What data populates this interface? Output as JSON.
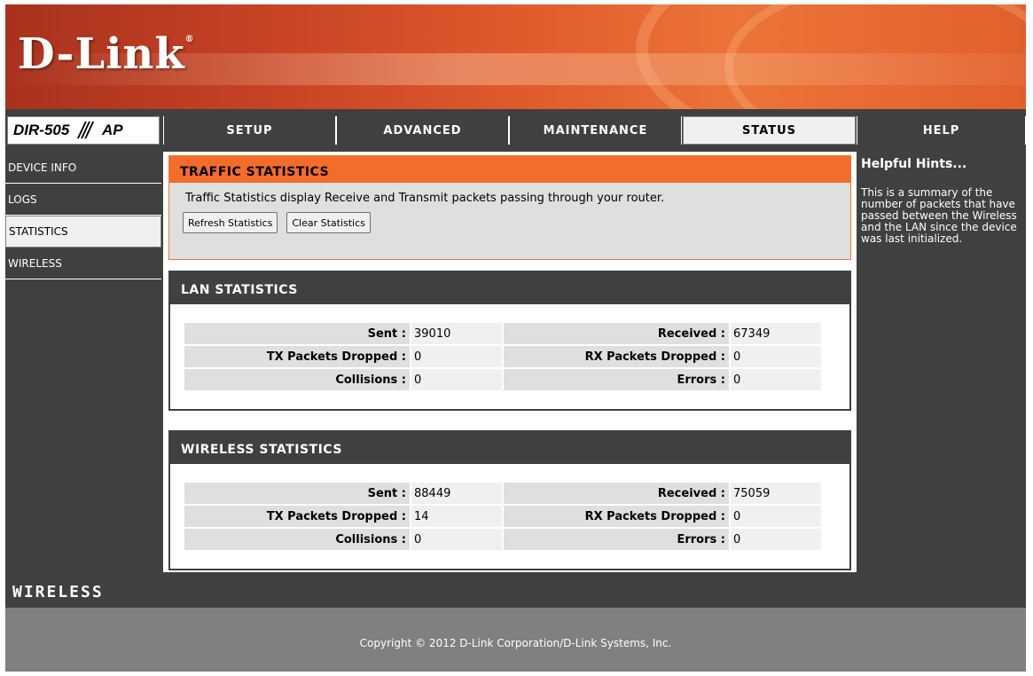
{
  "header": {
    "logo": "D-Link",
    "logo_mark": "®"
  },
  "model": {
    "name": "DIR-505",
    "separator": "///",
    "mode": "AP"
  },
  "nav": {
    "tabs": [
      {
        "label": "SETUP"
      },
      {
        "label": "ADVANCED"
      },
      {
        "label": "MAINTENANCE"
      },
      {
        "label": "STATUS",
        "active": true
      },
      {
        "label": "HELP"
      }
    ]
  },
  "sidebar": {
    "items": [
      {
        "label": "DEVICE INFO"
      },
      {
        "label": "LOGS"
      },
      {
        "label": "STATISTICS",
        "active": true
      },
      {
        "label": "WIRELESS"
      }
    ]
  },
  "traffic": {
    "title": "TRAFFIC STATISTICS",
    "description": "Traffic Statistics display Receive and Transmit packets passing through your router.",
    "refresh_label": "Refresh Statistics",
    "clear_label": "Clear Statistics"
  },
  "lan": {
    "title": "LAN STATISTICS",
    "sent_label": "Sent :",
    "sent": "39010",
    "received_label": "Received :",
    "received": "67349",
    "tx_dropped_label": "TX Packets Dropped :",
    "tx_dropped": "0",
    "rx_dropped_label": "RX Packets Dropped :",
    "rx_dropped": "0",
    "collisions_label": "Collisions :",
    "collisions": "0",
    "errors_label": "Errors :",
    "errors": "0"
  },
  "wireless": {
    "title": "WIRELESS STATISTICS",
    "sent_label": "Sent :",
    "sent": "88449",
    "received_label": "Received :",
    "received": "75059",
    "tx_dropped_label": "TX Packets Dropped :",
    "tx_dropped": "14",
    "rx_dropped_label": "RX Packets Dropped :",
    "rx_dropped": "0",
    "collisions_label": "Collisions :",
    "collisions": "0",
    "errors_label": "Errors :",
    "errors": "0"
  },
  "hints": {
    "title": "Helpful Hints...",
    "text": "This is a summary of the number of packets that have passed between the Wireless and the LAN since the device was last initialized."
  },
  "footer": {
    "brand": "WIRELESS",
    "copyright": "Copyright © 2012 D-Link Corporation/D-Link Systems, Inc."
  },
  "colors": {
    "accent": "#f36c2a",
    "panel_dark": "#404040",
    "panel_light": "#dfdfdf"
  }
}
